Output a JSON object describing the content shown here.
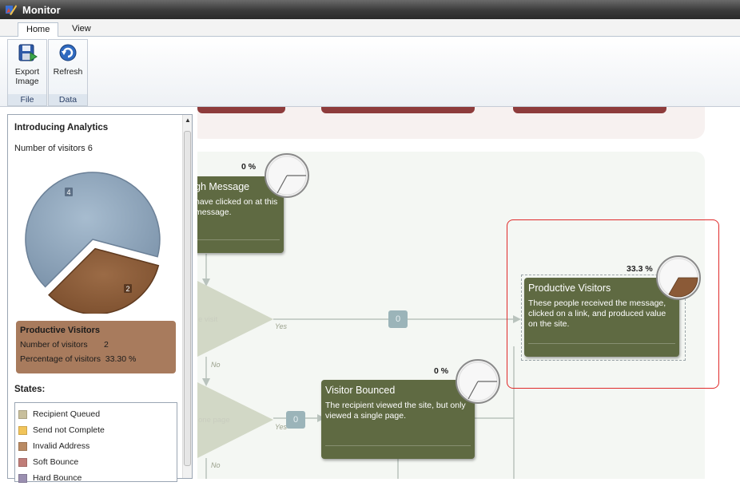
{
  "window": {
    "title": "Monitor"
  },
  "ribbon": {
    "tabs": [
      {
        "label": "Home"
      },
      {
        "label": "View"
      }
    ],
    "groups": {
      "file": {
        "label": "File",
        "export_label_1": "Export",
        "export_label_2": "Image"
      },
      "data": {
        "label": "Data",
        "refresh_label": "Refresh"
      }
    }
  },
  "left_panel": {
    "title": "Introducing Analytics",
    "visitors_text": "Number of visitors  6",
    "pie": {
      "slices": [
        {
          "label": "4",
          "value": 4,
          "color": "#8fa6bc"
        },
        {
          "label": "2",
          "value": 2,
          "color": "#8b5a37"
        }
      ]
    },
    "detail": {
      "title": "Productive Visitors",
      "visitors_line": "Number of visitors       2",
      "percentage_line": "Percentage of visitors  33.30 %"
    },
    "states_title": "States:",
    "states": [
      {
        "label": "Recipient Queued",
        "color": "#c8bf9c"
      },
      {
        "label": "Send not Complete",
        "color": "#f1c45a"
      },
      {
        "label": "Invalid Address",
        "color": "#b98a63"
      },
      {
        "label": "Soft Bounce",
        "color": "#c07d78"
      },
      {
        "label": "Hard Bounce",
        "color": "#9a8fb0"
      }
    ]
  },
  "canvas": {
    "node_message": {
      "title": "gh Message",
      "desc": "have clicked on at this message.",
      "percent": "0 %"
    },
    "node_productive": {
      "title": "Productive Visitors",
      "desc": "These people received the message, clicked on a link, and produced value on the site.",
      "percent": "33.3 %",
      "fraction": 0.333
    },
    "node_bounced": {
      "title": "Visitor Bounced",
      "desc": "The recipient viewed the site, but only viewed a single page.",
      "percent": "0 %"
    },
    "decision_visit": {
      "label": "e visit",
      "yes": "Yes",
      "no": "No",
      "count": "0"
    },
    "decision_page": {
      "label": "one page",
      "yes": "Yes",
      "no": "No",
      "count": "0"
    }
  },
  "colors": {
    "node_green": "#5f6a42",
    "highlight_red": "#e02a2a",
    "productive_brown": "#8b5a37"
  }
}
